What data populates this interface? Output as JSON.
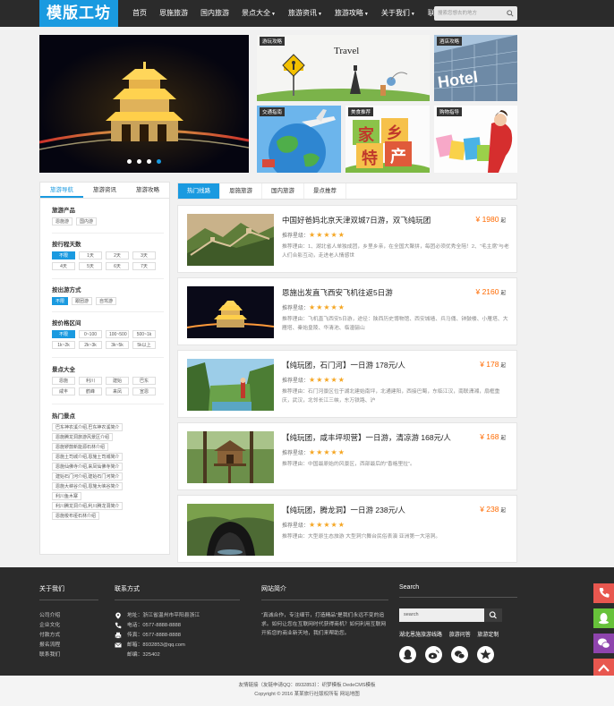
{
  "header": {
    "logo": "模版工坊",
    "nav": [
      {
        "label": "首页",
        "caret": false
      },
      {
        "label": "恩施旅游",
        "caret": false
      },
      {
        "label": "国内旅游",
        "caret": false
      },
      {
        "label": "景点大全",
        "caret": true
      },
      {
        "label": "旅游资讯",
        "caret": true
      },
      {
        "label": "旅游攻略",
        "caret": true
      },
      {
        "label": "关于我们",
        "caret": true
      },
      {
        "label": "联系我们",
        "caret": false
      }
    ],
    "caret_glyph": "▼",
    "search_placeholder": "搜索您想去的地方"
  },
  "tiles": {
    "travel": {
      "tag": "游玩攻略",
      "word": "Travel"
    },
    "hotel": {
      "tag": "酒店攻略",
      "word": "Hotel"
    },
    "traffic": {
      "tag": "交通指南"
    },
    "food": {
      "tag": "美食推荐",
      "chars": [
        "家",
        "乡",
        "特",
        "产"
      ]
    },
    "shopping": {
      "tag": "购物指导"
    }
  },
  "sidebar": {
    "tabs": [
      "旅游导航",
      "旅游资讯",
      "旅游攻略"
    ],
    "products": {
      "title": "旅游产品",
      "items": [
        "恩施游",
        "国内游"
      ]
    },
    "days": {
      "title": "按行程天数",
      "items": [
        "不限",
        "1天",
        "2天",
        "3天",
        "4天",
        "5天",
        "6天",
        "7天"
      ]
    },
    "method": {
      "title": "按出游方式",
      "items": [
        "不限",
        "跟团游",
        "自驾游"
      ]
    },
    "price": {
      "title": "按价格区间",
      "items": [
        "不限",
        "0~100",
        "100~500",
        "500~1k",
        "1k~2k",
        "2k~3k",
        "3k~5k",
        "5k以上"
      ]
    },
    "spots": {
      "title": "景点大全",
      "items": [
        "恩施",
        "利川",
        "建始",
        "巴东",
        "咸丰",
        "鹤峰",
        "来凤",
        "宣恩"
      ]
    },
    "hot": {
      "title": "热门景点",
      "items": [
        "巴东神农溪介绍,巴东神农溪简介",
        "恩施腾龙洞旅游风景区介绍",
        "恩施锣鼓新能源石林介绍",
        "恩施土司城介绍,恩施土司城简介",
        "恩施仙佛寺介绍,来凤仙佛寺简介",
        "建始石门河介绍,建始石门河简介",
        "恩施大峡谷介绍,恩施大峡谷简介",
        "利川鱼木寨",
        "利川腾龙洞介绍,利川腾龙洞简介",
        "恩施梭布垭石林介绍"
      ]
    }
  },
  "main": {
    "tabs": [
      "热门线路",
      "恩施旅游",
      "国内旅游",
      "景点推荐"
    ],
    "stars_label": "推荐星级：",
    "stars": "★★★★★",
    "price_prefix": "¥",
    "price_unit": "起",
    "cards": [
      {
        "title": "中国好爸妈北京天津双城7日游，双飞纯玩团",
        "price": "1980",
        "desc": "推荐理由：1、湖北省人单独成团，乡里乡亲，在全国大聚拼，每团必须优秀全陪！2、“毛主席”与老人们合影互动，走进老人情感世"
      },
      {
        "title": "恩施出发直飞西安飞机往返5日游",
        "price": "2160",
        "desc": "推荐理由：飞机直飞西安5日游，途径：陕西历史博物馆、西安城墙、兵马俑、钟鼓楼、小雁塔、大雁塔、秦始皇陵、华清池、临潼骊山"
      },
      {
        "title": "【纯玩团，石门河】一日游 178元/人",
        "price": "178",
        "desc": "推荐理由：石门河景区位于湖北建始南坪，北通建阳，西接巴蜀，东临江汉，南联潇湘，扇框重庆，武汉，北邻长江三峡，东万铁路、沪"
      },
      {
        "title": "【纯玩团，咸丰坪坝营】一日游，清凉游 168元/人",
        "price": "168",
        "desc": "推荐理由：中国最原始的风景区，西部最后的“香格里拉”。"
      },
      {
        "title": "【纯玩团，腾龙洞】一日游 238元/人",
        "price": "238",
        "desc": "推荐理由：大型原生态旅游 大型洞穴舞台民俗表演 亚洲第一大溶洞。"
      }
    ]
  },
  "footer": {
    "about_title": "关于我们",
    "about_links": [
      "公司介绍",
      "企业文化",
      "付款方式",
      "报名流程",
      "联系我们"
    ],
    "contact_title": "联系方式",
    "contact": [
      "地址：浙江省温州市平阳县浙江",
      "电话：0577-8888-8888",
      "传真：0577-8888-8888",
      "邮箱：8932853@qq.com",
      "邮编：325402"
    ],
    "intro_title": "网站简介",
    "intro": "“真诚合作，专注细节，打造精品”是我们永远不变的追求。如何让您在互联网时代获得商机？如何利用互联网开拓您的商业新天地，我们来帮助您。",
    "search_title": "Search",
    "search_placeholder": "search",
    "links": [
      "湖北恩施旅游线路",
      "旅游问答",
      "旅游定制"
    ]
  },
  "bottom": {
    "line1": "友情链接（友链申请QQ：8932853）：织梦模板  DedeCMS模板",
    "line2": "Copyright © 2016 某某旅行社版权所有  网站地图"
  },
  "colors": {
    "accent": "#1a9ae0",
    "price": "#ff6a00",
    "star": "#f5a623",
    "dark": "#2b2b2b"
  }
}
